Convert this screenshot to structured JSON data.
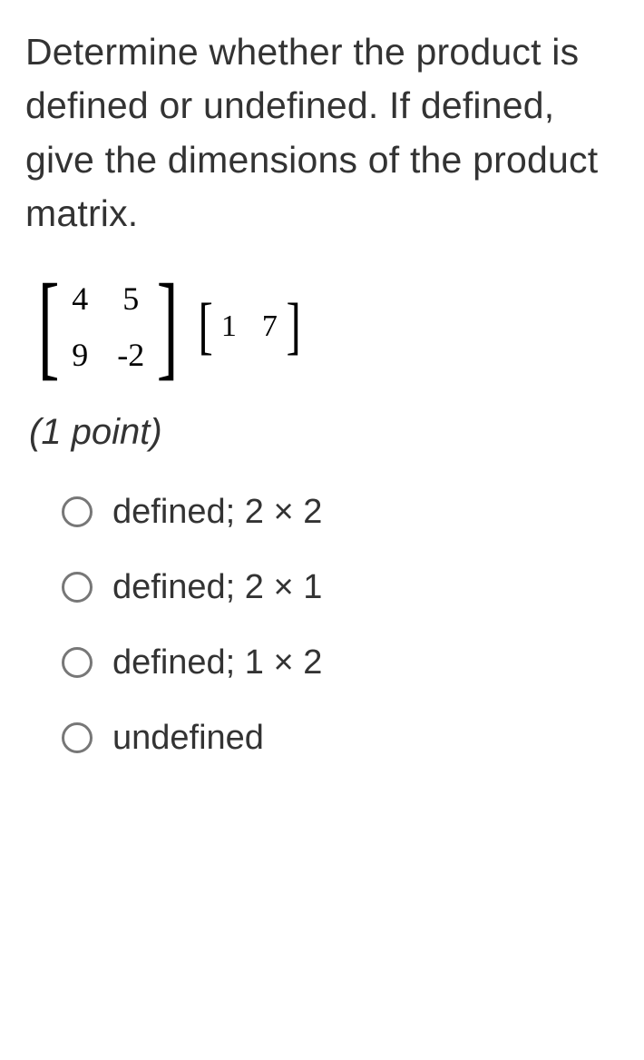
{
  "question": {
    "prompt": "Determine whether the product is defined or undefined. If defined, give the dimensions of the product matrix.",
    "points_label": "(1 point)"
  },
  "matrices": {
    "A": {
      "rows": 2,
      "cols": 2,
      "values": [
        [
          "4",
          "5"
        ],
        [
          "9",
          "-2"
        ]
      ]
    },
    "B": {
      "rows": 1,
      "cols": 2,
      "values": [
        [
          "1",
          "7"
        ]
      ]
    },
    "a00": "4",
    "a01": "5",
    "a10": "9",
    "a11": "-2",
    "b00": "1",
    "b01": "7"
  },
  "options": [
    {
      "label": "defined; 2 × 2"
    },
    {
      "label": "defined; 2 × 1"
    },
    {
      "label": "defined; 1 × 2"
    },
    {
      "label": "undefined"
    }
  ]
}
